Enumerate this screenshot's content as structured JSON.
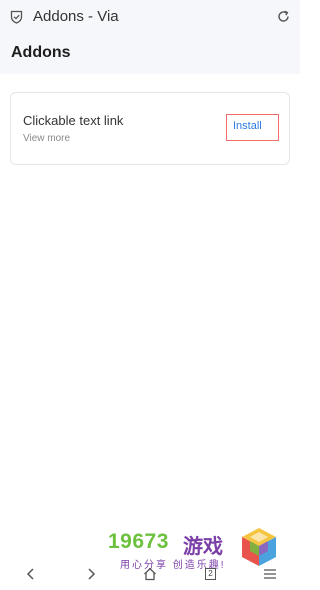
{
  "window": {
    "title": "Addons - Via"
  },
  "page": {
    "title": "Addons"
  },
  "addon": {
    "name": "Clickable text link",
    "more_label": "View more",
    "install_label": "Install"
  },
  "watermark": {
    "number": "19673",
    "brand": "游戏",
    "slogan": "用心分享 创造乐趣!"
  },
  "bottom_nav": {
    "tab_count": "2"
  },
  "icons": {
    "shield": "shield-icon",
    "refresh": "refresh-icon",
    "back": "back-arrow-icon",
    "forward": "forward-arrow-icon",
    "home": "home-icon",
    "tabs": "tabs-icon",
    "menu": "menu-icon"
  },
  "colors": {
    "accent": "#2a7be4",
    "highlight_box": "#f36b6b",
    "topbar_bg": "#f6f7fa",
    "watermark_green": "#6ec13f",
    "watermark_purple": "#7b3fa8"
  }
}
